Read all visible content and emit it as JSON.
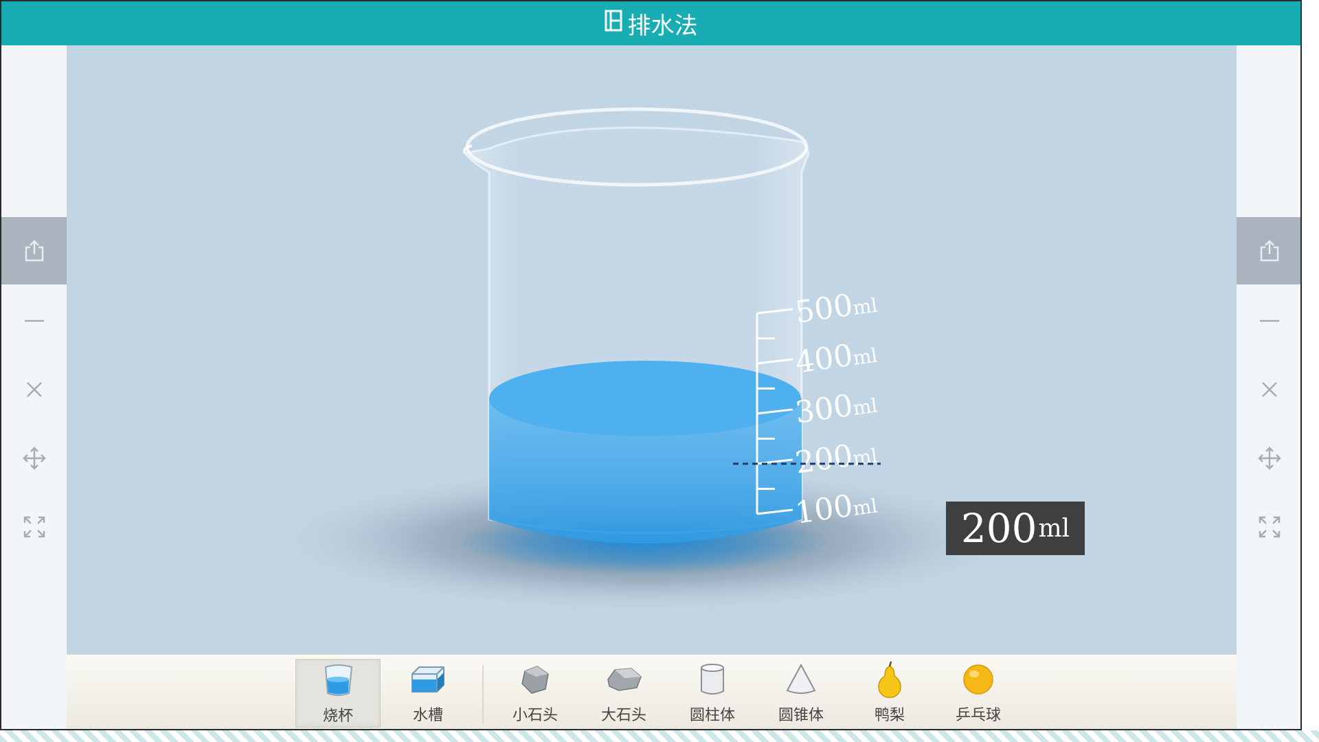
{
  "title": "排水法",
  "colors": {
    "titlebar": "#17adb3",
    "stage": "#c1d5e5",
    "water": "#3aa7e6",
    "readout_bg": "#3d3f40"
  },
  "sidebar": {
    "tools": [
      {
        "icon": "share-icon",
        "active": true
      },
      {
        "icon": "minimize-icon",
        "active": false
      },
      {
        "icon": "close-icon",
        "active": false
      },
      {
        "icon": "move-icon",
        "active": false
      },
      {
        "icon": "fullscreen-icon",
        "active": false
      }
    ]
  },
  "beaker": {
    "scale_labels": [
      "500",
      "400",
      "300",
      "200",
      "100"
    ],
    "scale_unit": "ml",
    "water_level_ml": 200
  },
  "readout": {
    "value": "200",
    "unit": "ml"
  },
  "shelf": {
    "items": [
      {
        "label": "烧杯",
        "icon": "beaker-icon",
        "selected": true
      },
      {
        "label": "水槽",
        "icon": "water-tank-icon",
        "selected": false
      },
      {
        "label": "小石头",
        "icon": "small-stone-icon",
        "selected": false
      },
      {
        "label": "大石头",
        "icon": "large-stone-icon",
        "selected": false
      },
      {
        "label": "圆柱体",
        "icon": "cylinder-icon",
        "selected": false
      },
      {
        "label": "圆锥体",
        "icon": "cone-icon",
        "selected": false
      },
      {
        "label": "鸭梨",
        "icon": "pear-icon",
        "selected": false
      },
      {
        "label": "乒乓球",
        "icon": "ping-pong-ball-icon",
        "selected": false
      }
    ]
  }
}
